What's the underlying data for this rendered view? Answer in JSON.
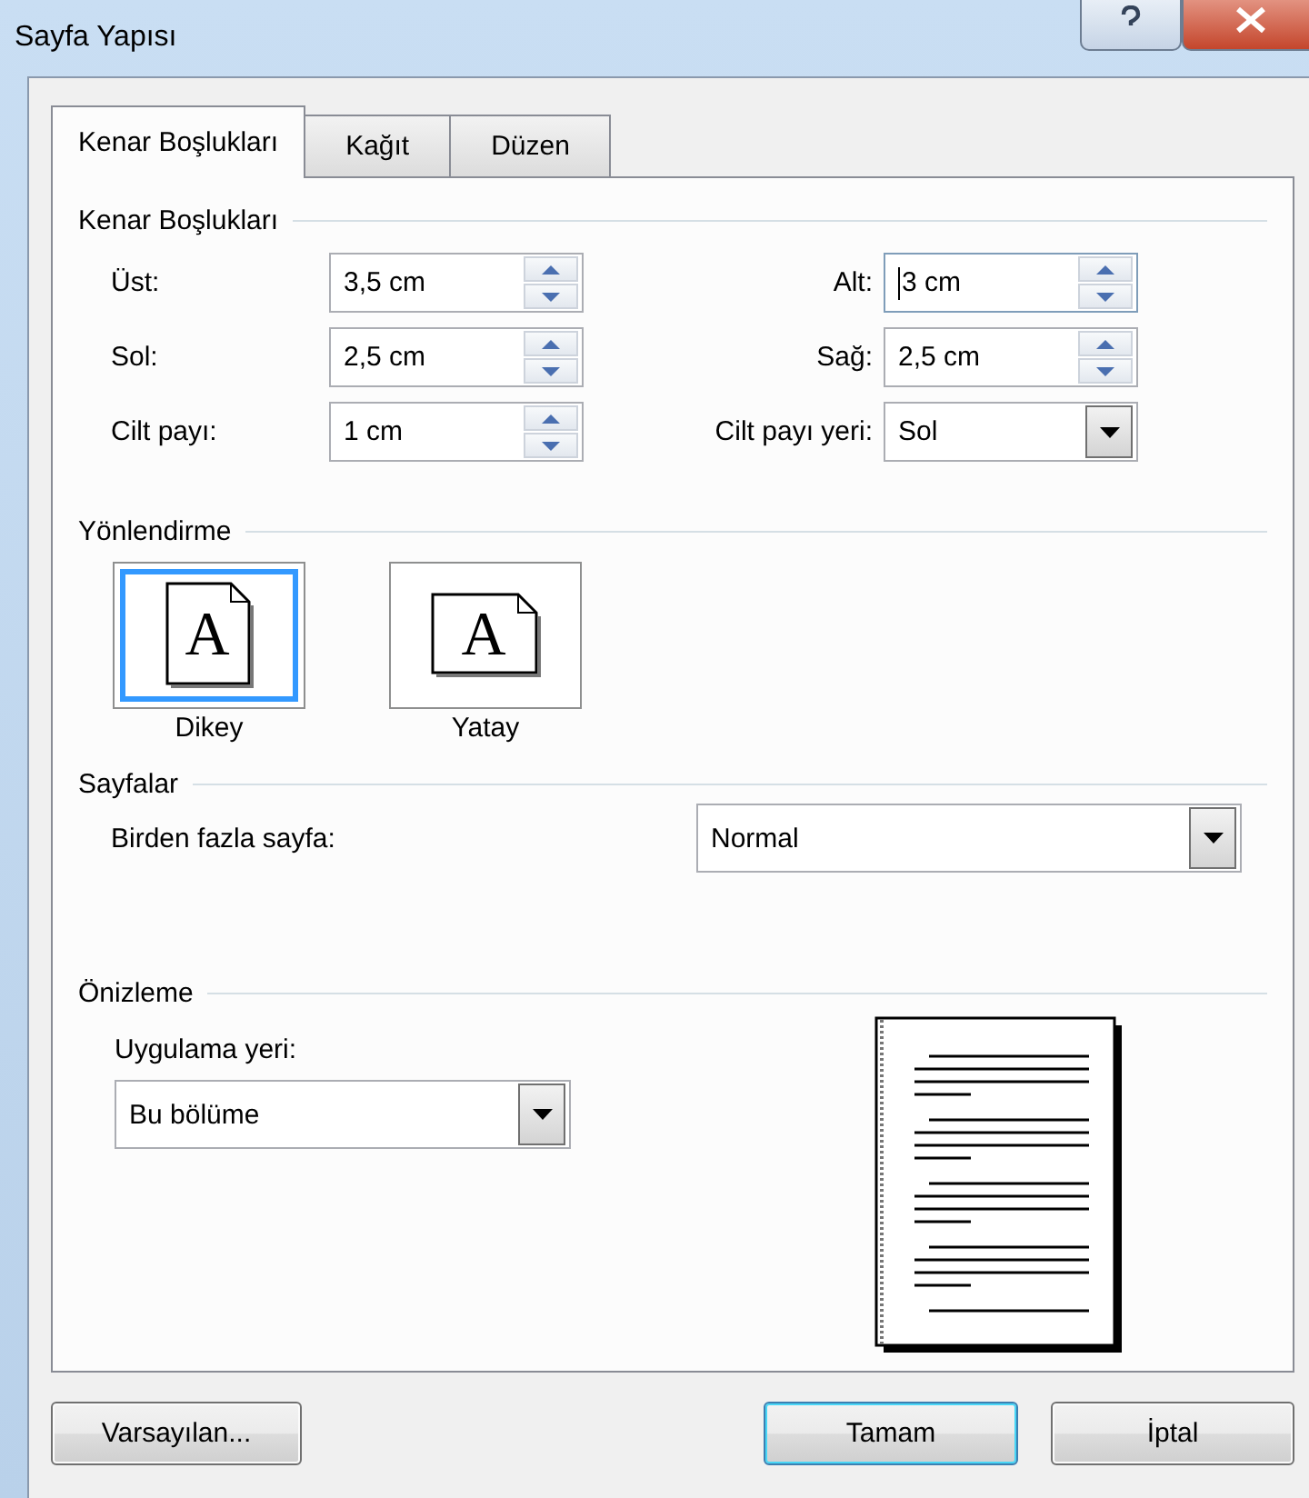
{
  "window": {
    "title": "Sayfa Yapısı"
  },
  "tabs": [
    {
      "label": "Kenar Boşlukları",
      "selected": true
    },
    {
      "label": "Kağıt",
      "selected": false
    },
    {
      "label": "Düzen",
      "selected": false
    }
  ],
  "margins": {
    "title": "Kenar Boşlukları",
    "fields": [
      {
        "label": "Üst:",
        "value": "3,5 cm",
        "kind": "spin",
        "focused": false
      },
      {
        "label": "Alt:",
        "value": "3 cm",
        "kind": "spin",
        "focused": true
      },
      {
        "label": "Sol:",
        "value": "2,5 cm",
        "kind": "spin",
        "focused": false
      },
      {
        "label": "Sağ:",
        "value": "2,5 cm",
        "kind": "spin",
        "focused": false
      },
      {
        "label": "Cilt payı:",
        "value": "1 cm",
        "kind": "spin",
        "focused": false
      },
      {
        "label": "Cilt payı yeri:",
        "value": "Sol",
        "kind": "select",
        "focused": false
      }
    ]
  },
  "orientation": {
    "title": "Yönlendirme",
    "options": [
      {
        "label": "Dikey",
        "glyph": "A",
        "kind": "portrait",
        "selected": true
      },
      {
        "label": "Yatay",
        "glyph": "A",
        "kind": "landscape",
        "selected": false
      }
    ]
  },
  "pages": {
    "title": "Sayfalar",
    "label": "Birden fazla sayfa:",
    "value": "Normal"
  },
  "preview": {
    "title": "Önizleme",
    "apply_label": "Uygulama yeri:",
    "apply_value": "Bu bölüme"
  },
  "buttons": [
    {
      "label": "Varsayılan...",
      "default": false
    },
    {
      "label": "Tamam",
      "default": true
    },
    {
      "label": "İptal",
      "default": false
    }
  ]
}
